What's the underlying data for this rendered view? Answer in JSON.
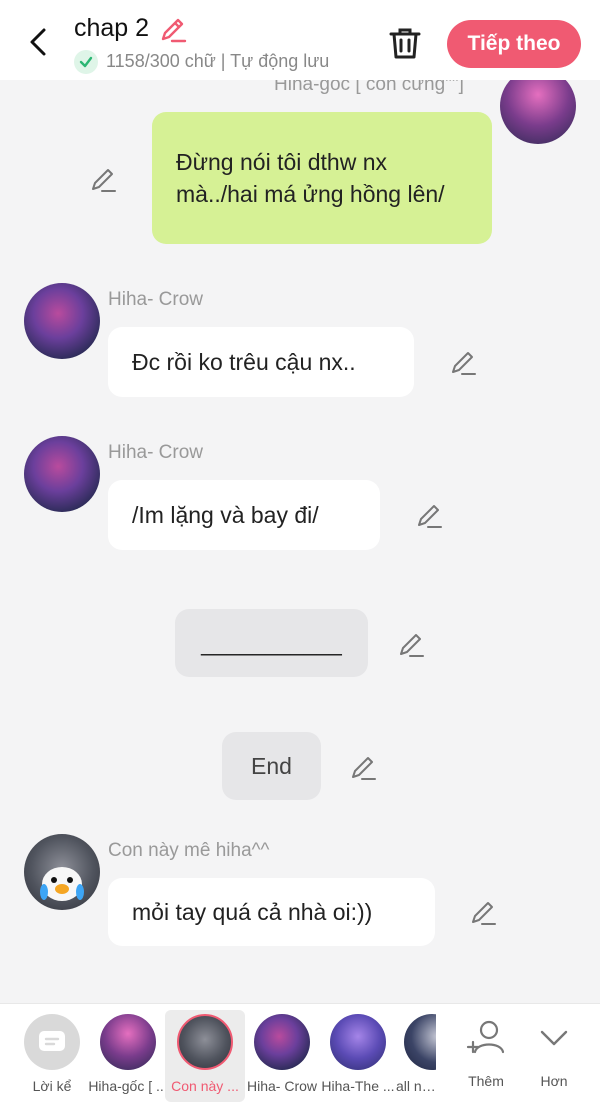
{
  "header": {
    "title": "chap 2",
    "status_text": "1158/300 chữ | Tự động lưu",
    "next_label": "Tiếp theo",
    "accent_color": "#f05a72"
  },
  "messages": [
    {
      "sender": "Hiha-gốc [ con cưng\"\"]",
      "text": "Đừng nói tôi dthw nx mà../hai má ửng hồng lên/",
      "side": "right",
      "bubble_color": "#d6f195"
    },
    {
      "sender": "Hiha- Crow",
      "text": "Đc rồi ko trêu cậu nx..",
      "side": "left"
    },
    {
      "sender": "Hiha- Crow",
      "text": "/Im lặng và bay đi/",
      "side": "left"
    },
    {
      "text": "___________",
      "side": "center"
    },
    {
      "text": "End",
      "side": "center"
    },
    {
      "sender": "Con này mê hiha^^",
      "text": "mỏi tay quá cả nhà oi:))",
      "side": "left"
    }
  ],
  "bottom_bar": {
    "characters": [
      {
        "label": "Lời kể",
        "icon": "chat-bubble-icon"
      },
      {
        "label": "Hiha-gốc [ ..."
      },
      {
        "label": "Con này ...",
        "selected": true
      },
      {
        "label": "Hiha- Crow"
      },
      {
        "label": "Hiha-The ..."
      },
      {
        "label": "all nhà"
      }
    ],
    "more_label": "Thêm",
    "other_label": "Hơn"
  }
}
